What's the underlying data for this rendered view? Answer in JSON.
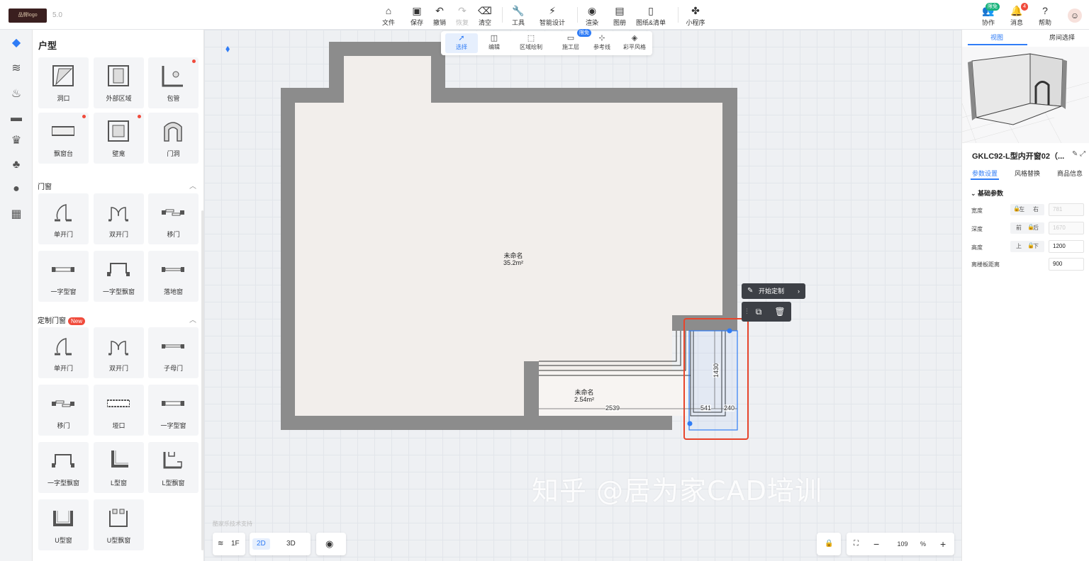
{
  "header": {
    "logo_text": "品牌logo",
    "version": "5.0",
    "tools": [
      {
        "label": "文件",
        "icon": "home-icon"
      },
      {
        "label": "保存",
        "icon": "save-icon"
      },
      {
        "label": "撤销",
        "icon": "undo-icon"
      },
      {
        "label": "恢复",
        "icon": "redo-icon"
      },
      {
        "label": "清空",
        "icon": "eraser-icon"
      },
      {
        "label": "工具",
        "icon": "wrench-icon"
      },
      {
        "label": "智能设计",
        "icon": "lightning-icon"
      },
      {
        "label": "渲染",
        "icon": "camera-icon"
      },
      {
        "label": "图册",
        "icon": "album-icon"
      },
      {
        "label": "图纸&清单",
        "icon": "document-icon"
      },
      {
        "label": "小程序",
        "icon": "puzzle-icon"
      }
    ],
    "right": {
      "collab_label": "协作",
      "collab_badge": "限免",
      "msg_label": "消息",
      "msg_badge": "4",
      "help_label": "帮助"
    }
  },
  "library": {
    "title": "户型",
    "top_items": [
      "洞口",
      "外部区域",
      "包管",
      "飘窗台",
      "壁龛",
      "门洞"
    ],
    "sections": [
      {
        "title": "门窗",
        "items": [
          "单开门",
          "双开门",
          "移门",
          "一字型窗",
          "一字型飘窗",
          "落地窗"
        ]
      },
      {
        "title": "定制门窗",
        "badge": "New",
        "items": [
          "单开门",
          "双开门",
          "子母门",
          "移门",
          "垭口",
          "一字型窗",
          "一字型飘窗",
          "L型窗",
          "L型飘窗",
          "U型窗",
          "U型飘窗"
        ]
      }
    ]
  },
  "canvas": {
    "subtools": [
      {
        "label": "选择",
        "active": true
      },
      {
        "label": "编辑"
      },
      {
        "label": "区域绘制"
      },
      {
        "label": "施工层",
        "badge": "限免"
      },
      {
        "label": "参考线"
      },
      {
        "label": "彩平风格"
      }
    ],
    "rooms": [
      {
        "name": "未命名",
        "area": "35.2m²"
      },
      {
        "name": "未命名",
        "area": "2.54m²"
      }
    ],
    "dimensions": [
      "2539",
      "541",
      "240",
      "1430"
    ],
    "context_menu": {
      "customize": "开始定制"
    },
    "support_text": "酷家乐技术支持",
    "floor_label": "1F",
    "view_2d": "2D",
    "view_3d": "3D",
    "zoom_value": "109",
    "zoom_unit": "%",
    "watermark": "知乎 @居为家CAD培训"
  },
  "right_panel": {
    "tabs": [
      "视图",
      "房间选择"
    ],
    "object_title": "GKLC92-L型内开窗02（...",
    "prop_tabs": [
      "参数设置",
      "风格替换",
      "商品信息"
    ],
    "group": "基础参数",
    "params": [
      {
        "label": "宽度",
        "opt1": "左",
        "opt2": "右",
        "value": "781",
        "disabled": true
      },
      {
        "label": "深度",
        "opt1": "前",
        "opt2": "后",
        "value": "1670",
        "disabled": true
      },
      {
        "label": "高度",
        "opt1": "上",
        "opt2": "下",
        "value": "1200",
        "disabled": false
      },
      {
        "label": "离楼板距离",
        "value": "900",
        "disabled": false
      }
    ]
  },
  "colors": {
    "accent": "#2f7cf6",
    "wall": "#8c8c8c",
    "floor": "#f2eeeb",
    "highlight": "#e8452c"
  }
}
